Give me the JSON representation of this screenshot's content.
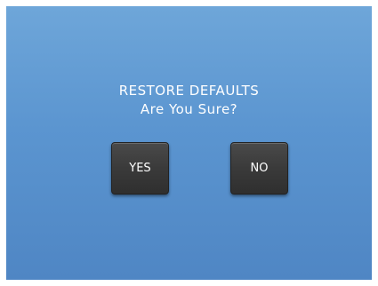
{
  "dialog": {
    "title": "RESTORE DEFAULTS",
    "question": "Are You Sure?",
    "yes_label": "YES",
    "no_label": "NO"
  },
  "colors": {
    "background_top": "#6ea6d9",
    "background_bottom": "#4f86c4",
    "button": "#3a3a3a",
    "text": "#ffffff"
  }
}
